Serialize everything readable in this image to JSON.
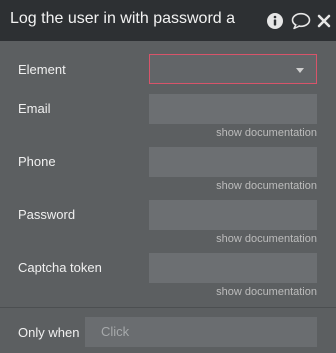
{
  "header": {
    "title": "Log the user in with password a"
  },
  "icons": {
    "info": "info-icon",
    "comment": "comment-icon",
    "close": "close-icon"
  },
  "fields": [
    {
      "label": "Element",
      "value": ""
    },
    {
      "label": "Email",
      "value": "",
      "doc_link": "show documentation"
    },
    {
      "label": "Phone",
      "value": "",
      "doc_link": "show documentation"
    },
    {
      "label": "Password",
      "value": "",
      "doc_link": "show documentation"
    },
    {
      "label": "Captcha token",
      "value": "",
      "doc_link": "show documentation"
    }
  ],
  "only_when": {
    "label": "Only when",
    "placeholder": "Click"
  },
  "colors": {
    "header_bg": "#2d3033",
    "panel_bg": "#5c5f61",
    "dropdown_border": "#d8546a"
  }
}
